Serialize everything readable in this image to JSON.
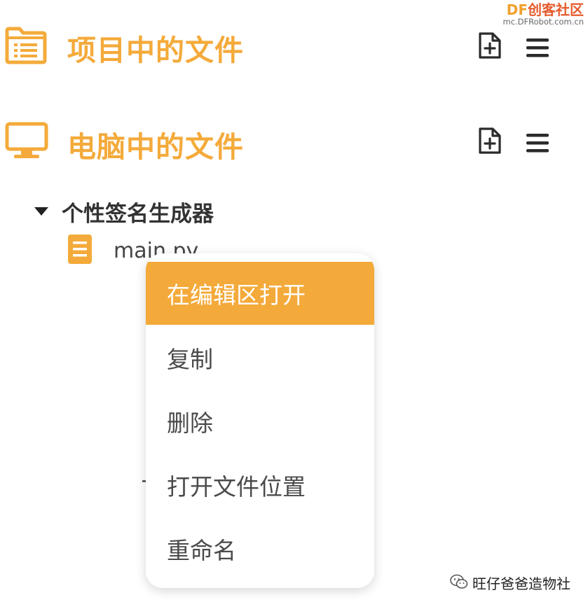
{
  "watermark": {
    "brand_df": "DF",
    "brand_rest": "创客社区",
    "url": "mc.DFRobot.com.cn"
  },
  "sections": {
    "project": {
      "title": "项目中的文件",
      "icon": "folder-list-icon"
    },
    "computer": {
      "title": "电脑中的文件",
      "icon": "monitor-icon"
    }
  },
  "header_icons": {
    "new_file": "new-file-icon",
    "menu": "hamburger-menu-icon"
  },
  "tree": {
    "folder": {
      "label": "个性签名生成器",
      "icon": "caret-down-icon"
    },
    "file": {
      "label": "main.py",
      "icon": "document-icon"
    },
    "obscured_mark": "+"
  },
  "context_menu": {
    "items": [
      {
        "label": "在编辑区打开",
        "active": true
      },
      {
        "label": "复制",
        "active": false
      },
      {
        "label": "删除",
        "active": false
      },
      {
        "label": "打开文件位置",
        "active": false
      },
      {
        "label": "重命名",
        "active": false
      }
    ]
  },
  "wechat_footer": {
    "label": "旺仔爸爸造物社",
    "icon": "wechat-icon"
  },
  "colors": {
    "accent": "#f4aa3a",
    "text_dark": "#333333",
    "menu_text": "#4a4a4a",
    "brand_red": "#e55b2c"
  }
}
